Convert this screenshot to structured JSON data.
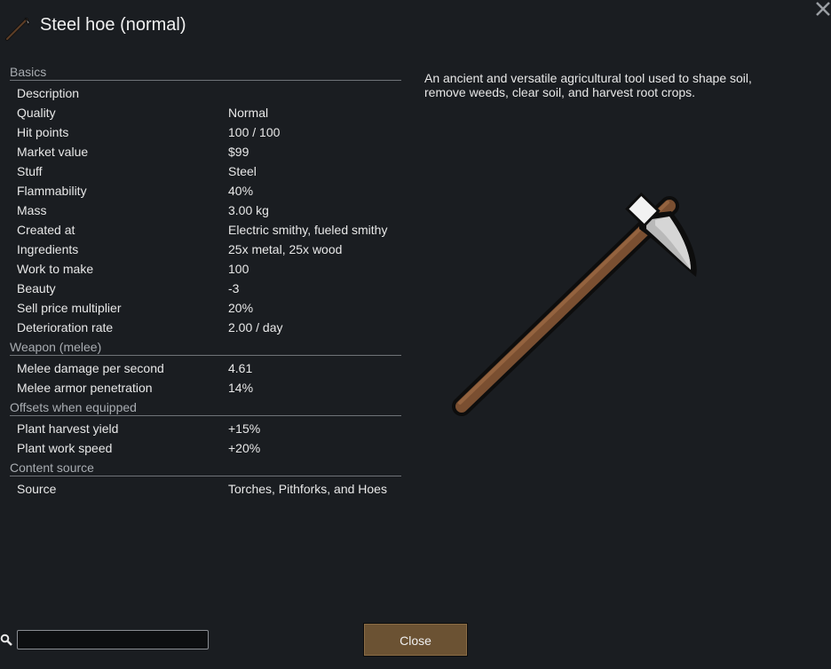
{
  "window": {
    "title": "Steel hoe (normal)",
    "title_icon": "hoe-icon",
    "close_icon": "close-icon"
  },
  "sections": [
    {
      "header": "Basics",
      "rows": [
        {
          "label": "Description",
          "value": ""
        },
        {
          "label": "Quality",
          "value": "Normal"
        },
        {
          "label": "Hit points",
          "value": "100 / 100"
        },
        {
          "label": "Market value",
          "value": "$99"
        },
        {
          "label": "Stuff",
          "value": "Steel"
        },
        {
          "label": "Flammability",
          "value": "40%"
        },
        {
          "label": "Mass",
          "value": "3.00 kg"
        },
        {
          "label": "Created at",
          "value": "Electric smithy, fueled smithy"
        },
        {
          "label": "Ingredients",
          "value": "25x metal, 25x wood"
        },
        {
          "label": "Work to make",
          "value": "100"
        },
        {
          "label": "Beauty",
          "value": "-3"
        },
        {
          "label": "Sell price multiplier",
          "value": "20%"
        },
        {
          "label": "Deterioration rate",
          "value": "2.00 / day"
        }
      ]
    },
    {
      "header": "Weapon (melee)",
      "rows": [
        {
          "label": "Melee damage per second",
          "value": "4.61"
        },
        {
          "label": "Melee armor penetration",
          "value": "14%"
        }
      ]
    },
    {
      "header": "Offsets when equipped",
      "rows": [
        {
          "label": "Plant harvest yield",
          "value": "+15%"
        },
        {
          "label": "Plant work speed",
          "value": "+20%"
        }
      ]
    },
    {
      "header": "Content source",
      "rows": [
        {
          "label": "Source",
          "value": "Torches, Pithforks, and Hoes"
        }
      ]
    }
  ],
  "description": "An ancient and versatile agricultural tool used to shape soil, remove weeds, clear soil, and harvest root crops.",
  "item_image": "steel-hoe-image",
  "footer": {
    "search_icon": "search-icon",
    "search_value": "",
    "close_label": "Close"
  },
  "colors": {
    "background": "#1a1d21",
    "button": "#6b5233",
    "handle": "#7a4f31",
    "blade": "#c8c8c8"
  }
}
